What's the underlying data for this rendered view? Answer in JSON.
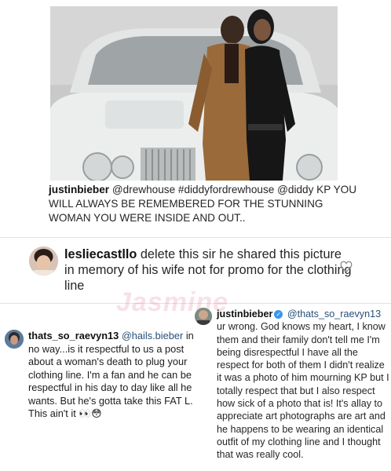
{
  "post": {
    "caption_user": "justinbieber",
    "caption_text": "@drewhouse #diddyfordrewhouse @diddy KP YOU WILL ALWAYS BE REMEMBERED FOR THE STUNNING WOMAN YOU WERE INSIDE AND OUT..",
    "colors": {
      "car": "#eef0f0",
      "jacket": "#9a6a3a",
      "dress": "#161616",
      "background": "#c8c8c8"
    }
  },
  "comment_1": {
    "user": "lesliecastllo",
    "text": "delete this sir he shared this picture in memory of his wife not for promo for the clothing line",
    "like_icon": "heart-outline-icon"
  },
  "watermark": {
    "text": "Jasmine"
  },
  "comment_2": {
    "user": "thats_so_raevyn13",
    "mention": "@hails.bieber",
    "text": "in no way...is it respectful to us a post about a woman's death to plug your clothing line. I'm a fan and he can be respectful in his day to day like all he wants. But he's gotta take this FAT L. This ain't it",
    "emoji": "👀😳"
  },
  "comment_3": {
    "user": "justinbieber",
    "verified_icon": "verified-badge-icon",
    "mention": "@thats_so_raevyn13",
    "text": "ur wrong. God knows my heart, I know them and their family don't tell me I'm being disrespectful I have all the respect for both of them I didn't realize it was a photo of him mourning KP but I totally respect that but I also respect how sick of a photo that is! It's allay to appreciate art photographs are art and he happens to be wearing an identical outfit of my clothing line and I thought that was really cool."
  }
}
